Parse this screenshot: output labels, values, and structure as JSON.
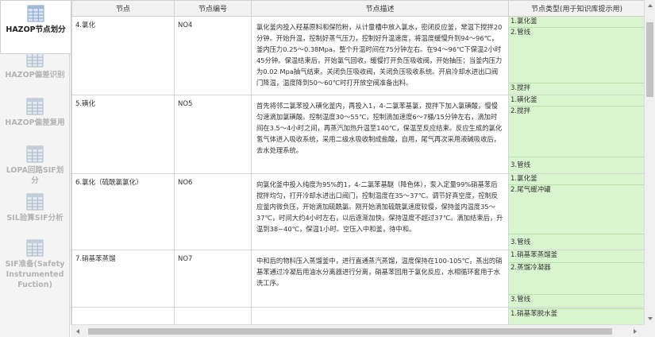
{
  "sidebar": {
    "items": [
      {
        "label": "HAZOP节点划分",
        "icon": "table-grid-icon",
        "active": true
      },
      {
        "label": "HAZOP偏差识别",
        "icon": "table-grid-icon",
        "active": false
      },
      {
        "label": "HAZOP偏差复用",
        "icon": "table-grid-icon",
        "active": false
      },
      {
        "label": "LOPA回路SIF划分",
        "icon": "table-grid-icon",
        "active": false
      },
      {
        "label": "SIL验算SIF分析",
        "icon": "table-grid-icon",
        "active": false
      },
      {
        "label": "SIF准备(Safety Instrumented Fuction)",
        "icon": "table-grid-icon",
        "active": false
      }
    ]
  },
  "table": {
    "headers": [
      "节点",
      "节点编号",
      "节点描述",
      "节点类型(用于知识库提示用)"
    ],
    "rows": [
      {
        "name": "4.氯化",
        "code": "NO4",
        "desc": "氯化釜内投入羟基原料和保险粉，从计量槽中放入氯水，密闭反应釜，常温下搅拌20分钟。开始升温，控制好蒸气压力，控制好升温速度，将温度缓慢升到94～96℃，釜内压力0.25～0.38Mpa。整个升温时间在75分钟左右。在94～96℃下保温2小时45分钟。保温结束后，开始氯气回收，缓慢打开负压吸收阀，开始抽压；当釜内压力为0.02 Mpa抽气结束。关闭负压吸收阀，关闭负压吸收系统。开启冷却水进出口阀门降温，温度降到50～60℃时打开放空阀准备出料。",
        "types": [
          "1.氯化釜",
          "2.管线",
          "3.搅拌"
        ]
      },
      {
        "name": "5.磺化",
        "code": "NO5",
        "desc": "首先将邻二氯苯投入磺化釜内，再投入1，4-二氯苯基氯，搅拌下加入氯磺酸，慢慢匀速滴加氯磺酸。控制温度30～55℃，控制滴加速度6～7桶/15分钟左右，滴加时间在3.5～4小时之间，再蒸汽加热升温至140℃，保温至反应结束。反应生成的氯化氢气体进入吸收系统，采用二级水吸收制成盐酸，自用，尾气再次采用液碱吸收后，去水处理系统。",
        "types": [
          "1.磺化釜",
          "2.搅拌",
          "3.管线"
        ]
      },
      {
        "name": "6.氯化（硫酰氯氯化）",
        "code": "NO6",
        "desc": "向氯化釜中投入纯度为95%的1，4-二氯苯基醚（降色体），泵入定量99%硝基苯后搅拌均匀，打开冷却水进出口阀门，控制温度在35～37℃。调节好真空度，控制反应釜内微负压，开始滴加硫酰氯。刚开始滴加硫酰氯速度较慢，保持釜内温度35～37℃，时间大约4小时左右，以后逐渐加快，保持温度不超过37℃。滴加结束后，升温到38~40℃，保温1小时。空压入中和釜，待中和。",
        "types": [
          "1.氯化釜",
          "2.尾气缓冲罐",
          "3.管线"
        ]
      },
      {
        "name": "7.硝基苯蒸馏",
        "code": "NO7",
        "desc": "中和后的物料压入蒸馏釜中，进行直通蒸汽蒸馏，温度保持在100-105℃，蒸出的硝基苯通过冷凝后用油水分离器进行分离，硝基苯回用于氯化反应，水相循环套用于水洗工序。",
        "types": [
          "1.硝基苯蒸馏釜",
          "2.蒸馏冷凝器",
          "3.管线"
        ]
      },
      {
        "name": "",
        "code": "",
        "desc": "",
        "types": [
          "1.硝基苯脱水釜"
        ]
      }
    ]
  },
  "colors": {
    "type_column_bg": "#d9f5cf",
    "header_bg": "#f2f2f2",
    "sidebar_bg": "#f4f4f4",
    "scrollbar_thumb": "#c2c2c2"
  }
}
